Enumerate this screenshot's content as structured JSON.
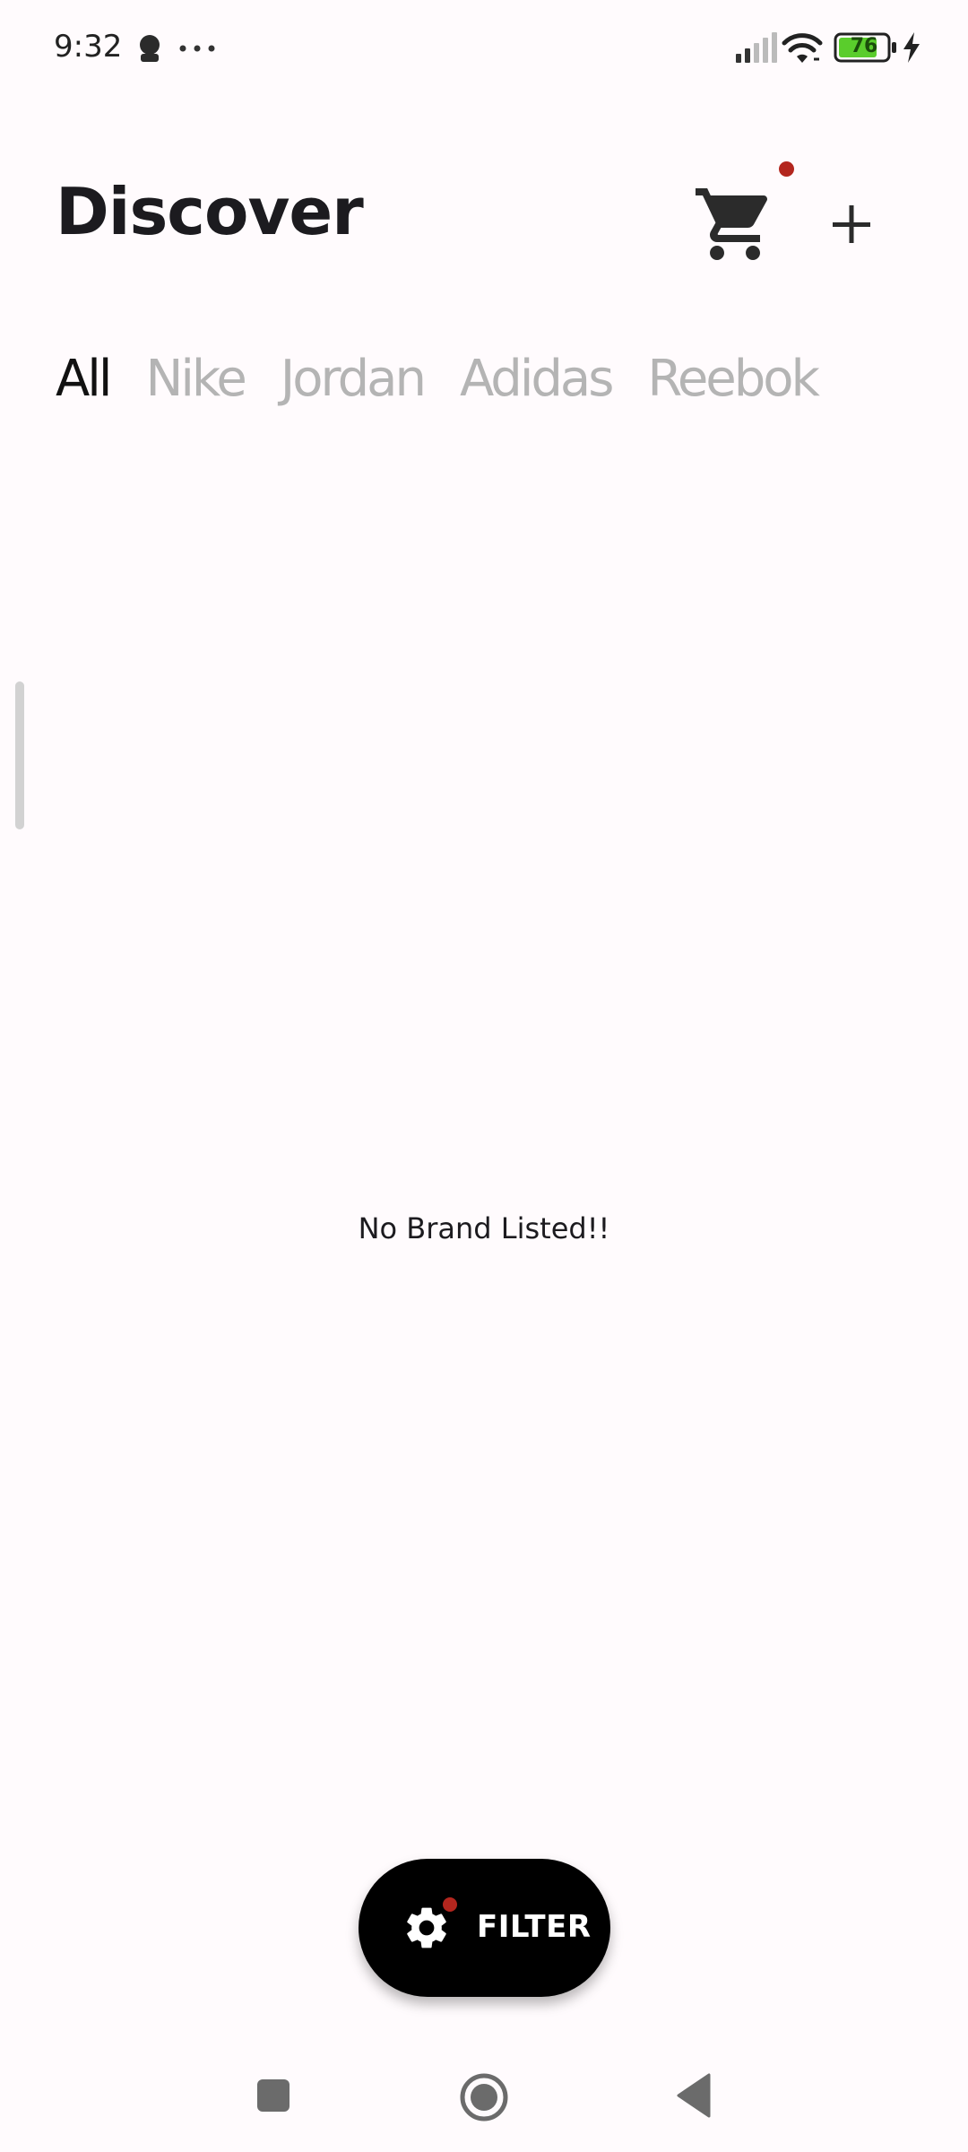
{
  "status_bar": {
    "time": "9:32",
    "battery_level": "76",
    "icons": [
      "person-icon",
      "more-dots-icon",
      "signal-icon",
      "wifi-icon",
      "battery-icon",
      "charging-bolt-icon"
    ]
  },
  "header": {
    "title": "Discover",
    "cart_icon": "cart-icon",
    "add_icon": "plus-icon"
  },
  "tabs": [
    {
      "label": "All",
      "active": true
    },
    {
      "label": "Nike",
      "active": false
    },
    {
      "label": "Jordan",
      "active": false
    },
    {
      "label": "Adidas",
      "active": false
    },
    {
      "label": "Reebok",
      "active": false
    }
  ],
  "main": {
    "empty_message": "No Brand Listed!!"
  },
  "fab": {
    "label": "FILTER",
    "icon": "gear-icon"
  },
  "colors": {
    "background": "#FFFBFD",
    "accent_dot": "#B3261E",
    "fab_background": "#000000",
    "inactive_tab": "#B4B4B4",
    "battery_fill": "#5ACD2C"
  }
}
